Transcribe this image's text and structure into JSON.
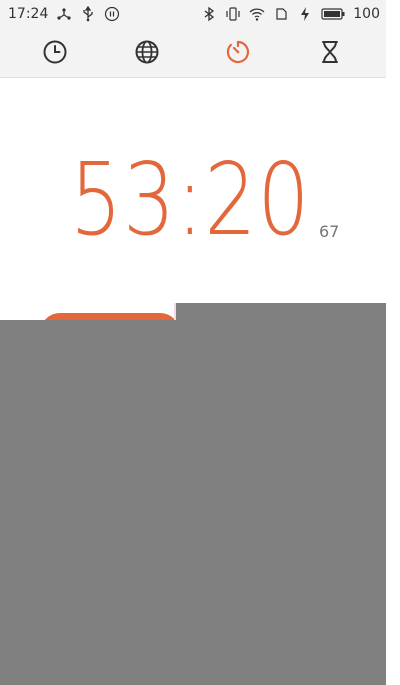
{
  "status_bar": {
    "time": "17:24",
    "left_icons": [
      "share-icon",
      "usb-icon",
      "pause-circle-icon"
    ],
    "right_icons": [
      "bluetooth-icon",
      "vibrate-icon",
      "wifi-icon",
      "sim-icon",
      "charging-icon",
      "battery-icon"
    ],
    "battery_level": "100"
  },
  "tabs": [
    {
      "name": "clock",
      "icon": "clock-icon",
      "active": false
    },
    {
      "name": "world-clock",
      "icon": "globe-icon",
      "active": false
    },
    {
      "name": "stopwatch",
      "icon": "stopwatch-icon",
      "active": true
    },
    {
      "name": "timer",
      "icon": "hourglass-icon",
      "active": false
    }
  ],
  "stopwatch": {
    "time_main": "53:20",
    "time_fraction": "67"
  },
  "colors": {
    "accent": "#e2683c",
    "inactive_icon": "#333333",
    "overlay": "#808080"
  }
}
